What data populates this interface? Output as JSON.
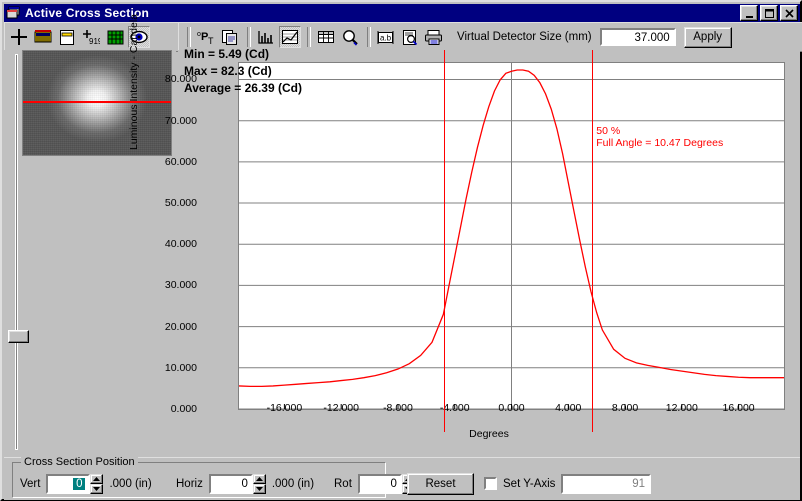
{
  "window": {
    "title": "Active Cross Section",
    "icon": "app-window-icon",
    "buttons": {
      "minimize": "_",
      "maximize": "□",
      "close": "✕"
    }
  },
  "toolbar_left": {
    "items": [
      {
        "name": "crosshair-icon",
        "pressed": false
      },
      {
        "name": "colorbar-icon",
        "pressed": false
      },
      {
        "name": "page-icon",
        "pressed": false
      },
      {
        "name": "crosshair-digits-icon",
        "pressed": false
      },
      {
        "name": "green-grid-icon",
        "pressed": false
      },
      {
        "name": "eye-icon",
        "pressed": true
      }
    ]
  },
  "toolbar_right": {
    "items": [
      {
        "name": "pt-label-icon",
        "pressed": false
      },
      {
        "name": "copy-icon",
        "pressed": false
      },
      {
        "name": "bar-chart-icon",
        "pressed": false
      },
      {
        "name": "line-chart-icon",
        "pressed": true
      },
      {
        "name": "table-grid-icon",
        "pressed": false
      },
      {
        "name": "magnifier-icon",
        "pressed": false
      },
      {
        "name": "ab-text-icon",
        "pressed": false
      },
      {
        "name": "print-preview-icon",
        "pressed": false
      },
      {
        "name": "printer-icon",
        "pressed": false
      }
    ],
    "detector_label": "Virtual Detector Size (mm)",
    "detector_value": "37.000",
    "apply_label": "Apply"
  },
  "chart_data": {
    "type": "line",
    "title": "",
    "xlabel": "Degrees",
    "ylabel": "Luminous Intensity - Candela",
    "xlim": [
      -19.2,
      19.2
    ],
    "ylim": [
      0,
      84
    ],
    "xticks": [
      "-16.000",
      "-12.000",
      "-8.000",
      "-4.000",
      "0.000",
      "4.000",
      "8.000",
      "12.000",
      "16.000"
    ],
    "xtick_values": [
      -16,
      -12,
      -8,
      -4,
      0,
      4,
      8,
      12,
      16
    ],
    "yticks": [
      "0.000",
      "10.000",
      "20.000",
      "30.000",
      "40.000",
      "50.000",
      "60.000",
      "70.000",
      "80.000"
    ],
    "ytick_values": [
      0,
      10,
      20,
      30,
      40,
      50,
      60,
      70,
      80
    ],
    "grid": "horizontal",
    "legend": "none",
    "series": [
      {
        "name": "Luminous Intensity",
        "color": "#ff0000",
        "x": [
          -19.2,
          -18.4,
          -17.6,
          -16.8,
          -16.0,
          -15.2,
          -14.4,
          -13.6,
          -12.8,
          -12.0,
          -11.2,
          -10.4,
          -9.6,
          -8.8,
          -8.0,
          -7.2,
          -6.4,
          -5.6,
          -4.8,
          -4.4,
          -4.0,
          -3.6,
          -3.2,
          -2.8,
          -2.4,
          -2.0,
          -1.6,
          -1.2,
          -0.8,
          -0.4,
          0.0,
          0.4,
          0.8,
          1.2,
          1.6,
          2.0,
          2.4,
          2.8,
          3.2,
          3.6,
          4.0,
          4.4,
          4.8,
          5.2,
          5.6,
          6.0,
          6.4,
          7.2,
          8.0,
          8.8,
          9.6,
          10.4,
          11.2,
          12.0,
          12.8,
          13.6,
          14.4,
          15.2,
          16.0,
          16.8,
          17.6,
          18.4,
          19.2
        ],
        "y": [
          5.6,
          5.5,
          5.5,
          5.6,
          5.8,
          6.0,
          6.2,
          6.4,
          6.6,
          6.9,
          7.2,
          7.6,
          8.1,
          8.8,
          9.7,
          11.0,
          13.0,
          16.2,
          23.0,
          30.0,
          37.0,
          44.0,
          51.0,
          57.5,
          63.5,
          68.8,
          73.4,
          77.2,
          79.9,
          81.5,
          82.0,
          82.3,
          82.3,
          82.0,
          81.0,
          79.2,
          76.5,
          72.8,
          68.0,
          62.0,
          55.0,
          48.0,
          41.1,
          34.5,
          28.5,
          23.4,
          19.2,
          14.5,
          12.3,
          11.2,
          10.6,
          10.1,
          9.6,
          9.2,
          8.8,
          8.4,
          8.1,
          7.9,
          7.7,
          7.6,
          7.6,
          7.6,
          7.6
        ]
      }
    ],
    "markers": [
      {
        "name": "half-max-left",
        "x": -4.78,
        "color": "#ff0000"
      },
      {
        "name": "half-max-right",
        "x": 5.69,
        "color": "#ff0000"
      }
    ],
    "stats": {
      "min": "Min = 5.49 (Cd)",
      "max": "Max = 82.3 (Cd)",
      "average": "Average = 26.39 (Cd)"
    },
    "annotation": {
      "percent": "50 %",
      "full_angle": "Full Angle = 10.47 Degrees"
    }
  },
  "bottom": {
    "group_title": "Cross Section Position",
    "vert_label": "Vert",
    "vert_value": "0",
    "vert_units": ".000 (in)",
    "horiz_label": "Horiz",
    "horiz_value": "0",
    "horiz_units": ".000 (in)",
    "rot_label": "Rot",
    "rot_value": "0",
    "reset_label": "Reset",
    "set_yaxis_label": "Set Y-Axis",
    "set_yaxis_checked": false,
    "yaxis_value": "91"
  },
  "colors": {
    "curve": "#ff0000",
    "marker": "#ff0000",
    "titlebar": "#000080",
    "face": "#c0c0c0",
    "plot_bg": "#ffffff",
    "gridline": "#808080"
  }
}
